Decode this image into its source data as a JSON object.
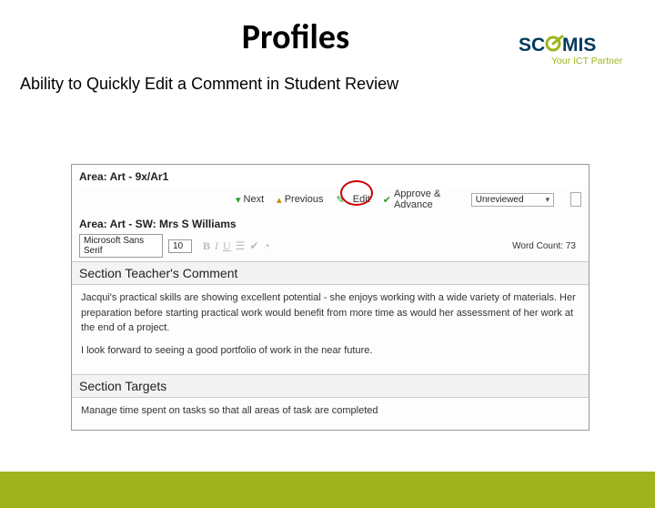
{
  "slide": {
    "title": "Profiles",
    "subtitle": "Ability to Quickly Edit a Comment in Student Review"
  },
  "logo": {
    "name": "SCOMIS",
    "tagline": "Your ICT Partner"
  },
  "window": {
    "title": "Area: Art - 9x/Ar1",
    "subarea": "Area: Art - SW: Mrs S Williams",
    "toolbar": {
      "next": "Next",
      "previous": "Previous",
      "edit": "Edit",
      "approve": "Approve & Advance",
      "status": "Unreviewed"
    },
    "format": {
      "font": "Microsoft Sans Serif",
      "size": "10",
      "wordcount": "Word Count: 73"
    },
    "sections": [
      {
        "header": "Section Teacher's Comment",
        "paragraphs": [
          "Jacqui's practical skills are showing excellent potential - she enjoys working with a wide variety of materials. Her preparation before starting practical work would benefit from more time as would her assessment of her work at the end of a project.",
          "I look forward to seeing a good portfolio of work in the near future."
        ]
      },
      {
        "header": "Section Targets",
        "paragraphs": [
          "Manage time spent on tasks so that all areas of task are completed"
        ]
      }
    ]
  }
}
